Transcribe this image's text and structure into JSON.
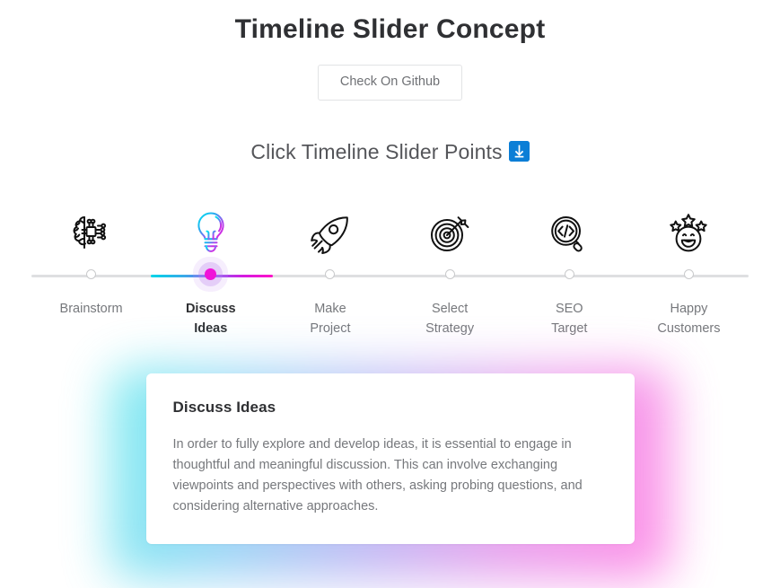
{
  "header": {
    "title": "Timeline Slider Concept",
    "github_button_label": "Check On Github",
    "subtitle": "Click Timeline Slider Points",
    "subtitle_emoji_name": "down-arrow-emoji"
  },
  "colors": {
    "accent_start": "#00d6e8",
    "accent_end": "#ff12c8",
    "active_dot": "#f012d8",
    "rail": "#dedfe1",
    "inactive_dot_border": "#c9cacc",
    "title_text": "#2f3033",
    "muted_text": "#76787c",
    "emoji_badge": "#0b7ed6",
    "button_border": "#e2e3e5"
  },
  "timeline": {
    "active_index": 1,
    "steps": [
      {
        "label": "Brainstorm",
        "icon": "brain-circuit-icon",
        "active": false
      },
      {
        "label": "Discuss\nIdeas",
        "icon": "lightbulb-icon",
        "active": true
      },
      {
        "label": "Make\nProject",
        "icon": "rocket-icon",
        "active": false
      },
      {
        "label": "Select\nStrategy",
        "icon": "target-arrow-icon",
        "active": false
      },
      {
        "label": "SEO\nTarget",
        "icon": "code-search-icon",
        "active": false
      },
      {
        "label": "Happy\nCustomers",
        "icon": "smiley-stars-icon",
        "active": false
      }
    ]
  },
  "detail_card": {
    "title": "Discuss Ideas",
    "body": "In order to fully explore and develop ideas, it is essential to engage in thoughtful and meaningful discussion. This can involve exchanging viewpoints and perspectives with others, asking probing questions, and considering alternative approaches."
  }
}
